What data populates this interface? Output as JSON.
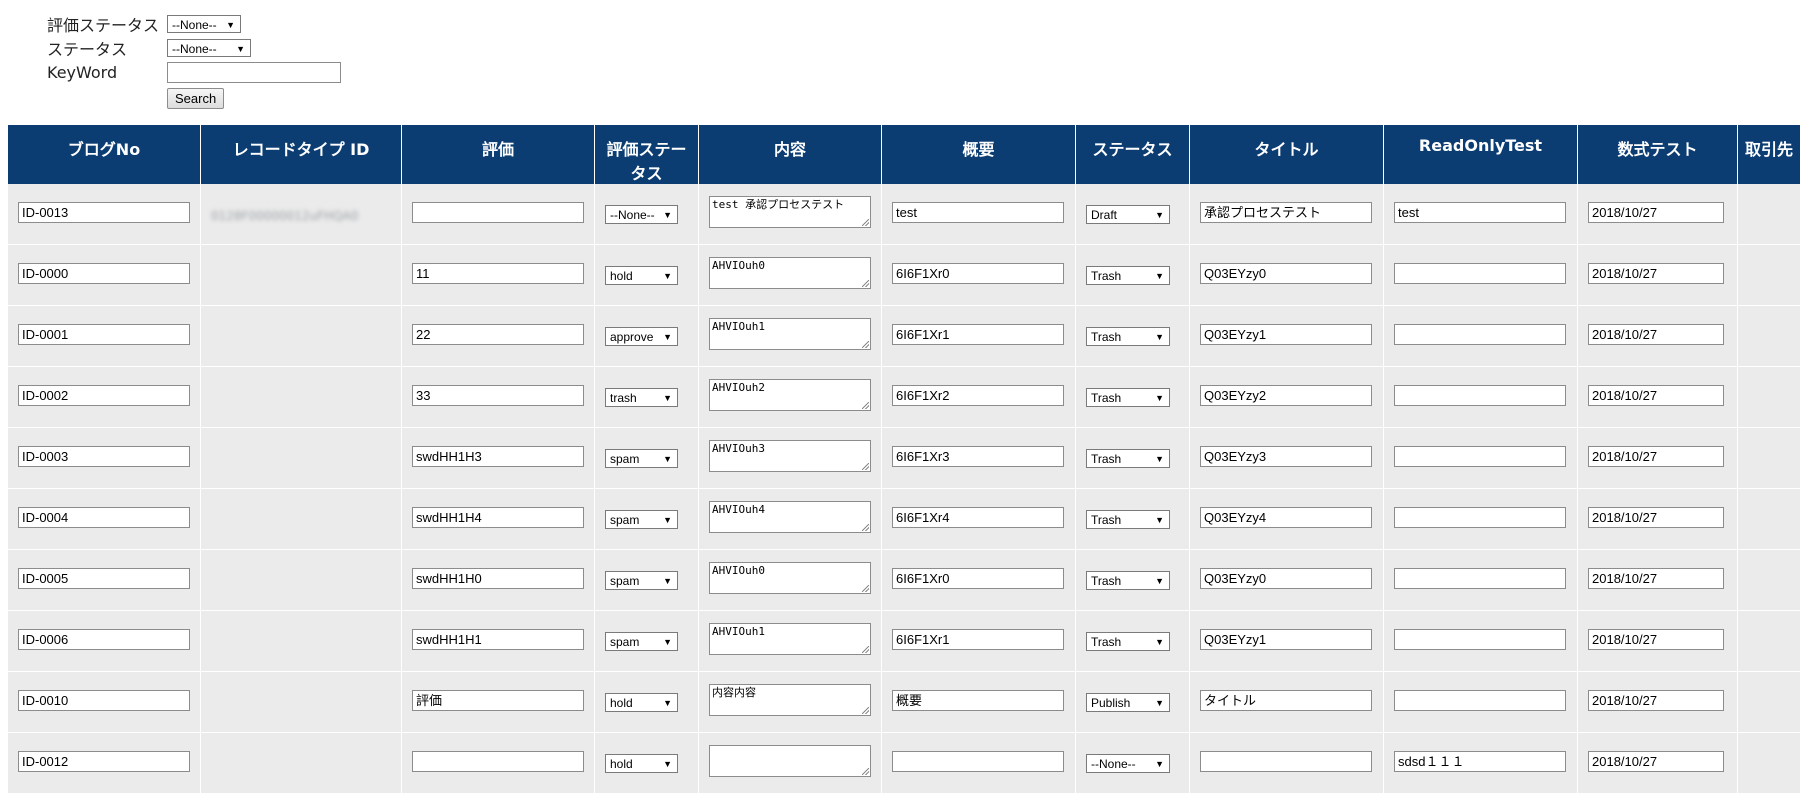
{
  "filters": {
    "eval_status_label": "評価ステータス",
    "eval_status_value": "--None--",
    "status_label": "ステータス",
    "status_value": "--None--",
    "keyword_label": "KeyWord",
    "keyword_value": "",
    "search_label": "Search"
  },
  "table": {
    "headers": [
      "ブログNo",
      "レコードタイプ ID",
      "評価",
      "評価ステータス",
      "内容",
      "概要",
      "ステータス",
      "タイトル",
      "ReadOnlyTest",
      "数式テスト",
      "取引先"
    ],
    "rows": [
      {
        "no": "ID-0013",
        "recid": "0128F00000012uFHQA0",
        "eval": "",
        "eval_status": "--None--",
        "content": "test 承認プロセステスト",
        "summary": "test",
        "status": "Draft",
        "title": "承認プロセステスト",
        "readonly": "test",
        "formula": "2018/10/27"
      },
      {
        "no": "ID-0000",
        "recid": "",
        "eval": "11",
        "eval_status": "hold",
        "content": "AHVIOuh0",
        "summary": "6I6F1Xr0",
        "status": "Trash",
        "title": "Q03EYzy0",
        "readonly": "",
        "formula": "2018/10/27"
      },
      {
        "no": "ID-0001",
        "recid": "",
        "eval": "22",
        "eval_status": "approve",
        "content": "AHVIOuh1",
        "summary": "6I6F1Xr1",
        "status": "Trash",
        "title": "Q03EYzy1",
        "readonly": "",
        "formula": "2018/10/27"
      },
      {
        "no": "ID-0002",
        "recid": "",
        "eval": "33",
        "eval_status": "trash",
        "content": "AHVIOuh2",
        "summary": "6I6F1Xr2",
        "status": "Trash",
        "title": "Q03EYzy2",
        "readonly": "",
        "formula": "2018/10/27"
      },
      {
        "no": "ID-0003",
        "recid": "",
        "eval": "swdHH1H3",
        "eval_status": "spam",
        "content": "AHVIOuh3",
        "summary": "6I6F1Xr3",
        "status": "Trash",
        "title": "Q03EYzy3",
        "readonly": "",
        "formula": "2018/10/27"
      },
      {
        "no": "ID-0004",
        "recid": "",
        "eval": "swdHH1H4",
        "eval_status": "spam",
        "content": "AHVIOuh4",
        "summary": "6I6F1Xr4",
        "status": "Trash",
        "title": "Q03EYzy4",
        "readonly": "",
        "formula": "2018/10/27"
      },
      {
        "no": "ID-0005",
        "recid": "",
        "eval": "swdHH1H0",
        "eval_status": "spam",
        "content": "AHVIOuh0",
        "summary": "6I6F1Xr0",
        "status": "Trash",
        "title": "Q03EYzy0",
        "readonly": "",
        "formula": "2018/10/27"
      },
      {
        "no": "ID-0006",
        "recid": "",
        "eval": "swdHH1H1",
        "eval_status": "spam",
        "content": "AHVIOuh1",
        "summary": "6I6F1Xr1",
        "status": "Trash",
        "title": "Q03EYzy1",
        "readonly": "",
        "formula": "2018/10/27"
      },
      {
        "no": "ID-0010",
        "recid": "",
        "eval": "評価",
        "eval_status": "hold",
        "content": "内容内容",
        "summary": "概要",
        "status": "Publish",
        "title": "タイトル",
        "readonly": "",
        "formula": "2018/10/27"
      },
      {
        "no": "ID-0012",
        "recid": "",
        "eval": "",
        "eval_status": "hold",
        "content": "",
        "summary": "",
        "status": "--None--",
        "title": "",
        "readonly": "sdsd１１１",
        "formula": "2018/10/27"
      }
    ]
  },
  "colors": {
    "header_bg": "#0b3d73",
    "row_bg": "#ebebeb"
  }
}
